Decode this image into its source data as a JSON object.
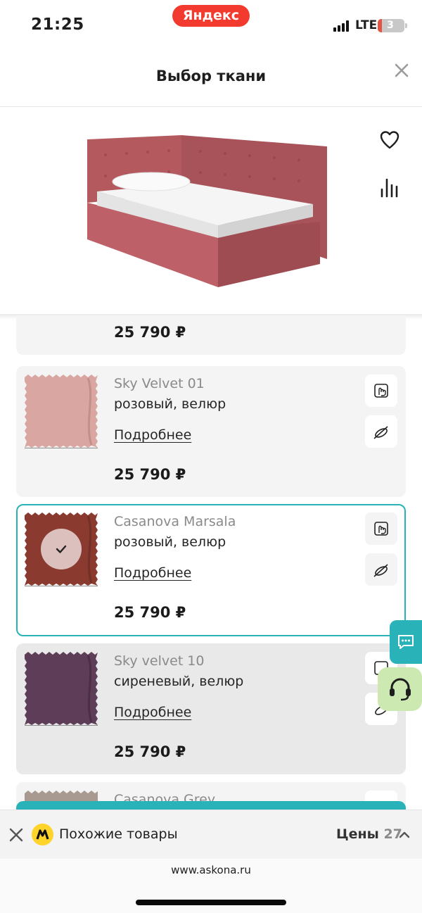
{
  "status": {
    "time": "21:25",
    "center_pill": "Яндекс",
    "network": "LTE",
    "battery": "3"
  },
  "header": {
    "title": "Выбор ткани"
  },
  "first_card_price": "25 790 ₽",
  "fabrics": [
    {
      "name": "Sky Velvet 01",
      "desc": "розовый, велюр",
      "more": "Подробнее",
      "price": "25 790 ₽",
      "color": "#d9a6a1"
    },
    {
      "name": "Casanova Marsala",
      "desc": "розовый, велюр",
      "more": "Подробнее",
      "price": "25 790 ₽",
      "color": "#8a3a2f",
      "selected": true
    },
    {
      "name": "Sky velvet 10",
      "desc": "сиреневый, велюр",
      "more": "Подробнее",
      "price": "25 790 ₽",
      "color": "#5e3d58"
    },
    {
      "name": "Casanova Grey",
      "color": "#a89a90"
    }
  ],
  "bottom_bar": {
    "similar": "Похожие товары",
    "prices_label": "Цены",
    "prices_count": "27"
  },
  "url": "www.askona.ru",
  "colors": {
    "accent": "#29b3b9",
    "yandex_red": "#f33a2e",
    "support_green": "#cde9b2"
  }
}
